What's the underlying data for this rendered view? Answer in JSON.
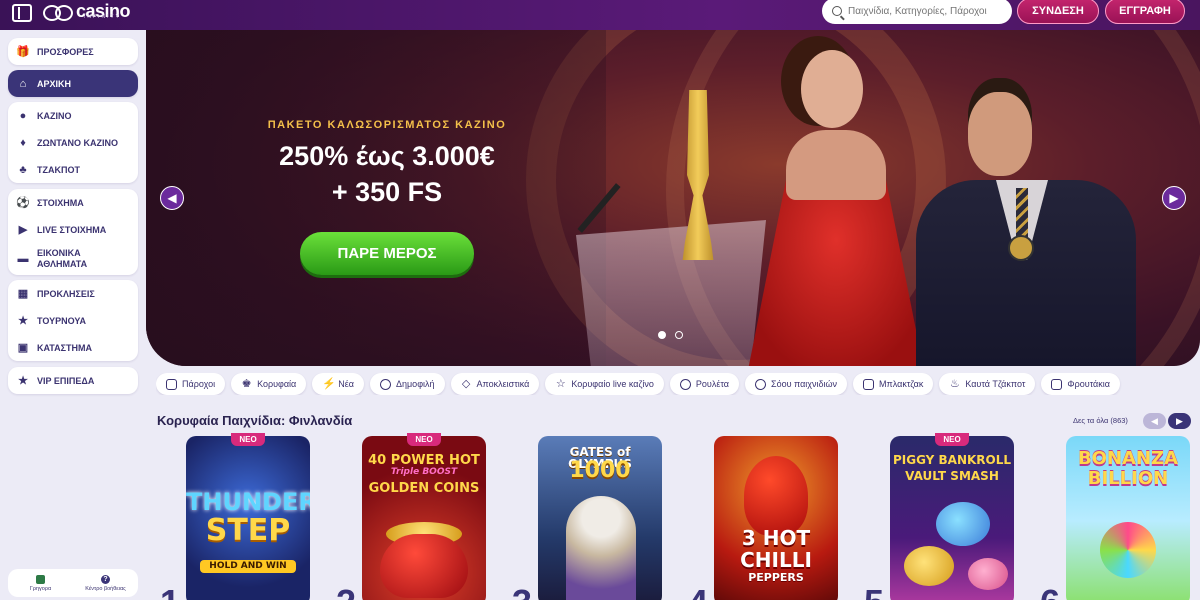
{
  "header": {
    "logo_text": "casino",
    "logo_sub": "INFINITY",
    "search_placeholder": "Παιχνίδια, Κατηγορίες, Πάροχοι",
    "login_label": "ΣΥΝΔΕΣΗ",
    "register_label": "ΕΓΓΡΑΦΗ",
    "accent_color": "#c4256e",
    "bar_color": "#4a155f"
  },
  "sidebar": {
    "items": [
      {
        "label": "ΠΡΟΣΦΟΡΕΣ",
        "icon": "gift-icon"
      },
      {
        "label": "ΑΡΧΙΚΗ",
        "icon": "home-icon",
        "active": true
      },
      {
        "label": "ΚΑΖΙΝΟ",
        "icon": "cherries-icon"
      },
      {
        "label": "ΖΩΝΤΑΝΟ ΚΑΖΙΝΟ",
        "icon": "cards-icon"
      },
      {
        "label": "ΤΖΑΚΠΟΤ",
        "icon": "clover-icon"
      },
      {
        "label": "ΣΤΟΙΧΗΜΑ",
        "icon": "soccer-ball-icon"
      },
      {
        "label": "LIVE ΣΤΟΙΧΗΜΑ",
        "icon": "live-play-icon"
      },
      {
        "label": "ΕΙΚΟΝΙΚΑ ΑΘΛΗΜΑΤΑ",
        "icon": "virtual-car-icon"
      },
      {
        "label": "ΠΡΟΚΛΗΣΕΙΣ",
        "icon": "challenge-icon"
      },
      {
        "label": "ΤΟΥΡΝΟΥΑ",
        "icon": "trophy-icon"
      },
      {
        "label": "ΚΑΤΑΣΤΗΜΑ",
        "icon": "shop-icon"
      },
      {
        "label": "VIP ΕΠΙΠΕΔΑ",
        "icon": "star-icon"
      }
    ],
    "footer": [
      {
        "label": "Γρηγορα",
        "icon": "language-flag-icon"
      },
      {
        "label": "Κέντρο βοήθειας",
        "icon": "help-icon"
      }
    ]
  },
  "hero": {
    "kicker": "ΠΑΚΕΤΟ ΚΑΛΩΣΟΡΙΣΜΑΤΟΣ ΚΑΖΙΝΟ",
    "title": "250% έως 3.000€",
    "subtitle": "+ 350 FS",
    "cta_label": "ΠΑΡΕ ΜΕΡΟΣ",
    "prev_icon": "chevron-left-icon",
    "next_icon": "chevron-right-icon",
    "slide_count": 2,
    "active_slide": 1
  },
  "categories": [
    {
      "label": "Πάροχοι",
      "icon": "providers-icon"
    },
    {
      "label": "Κορυφαία",
      "icon": "crown-icon"
    },
    {
      "label": "Νέα",
      "icon": "new-icon"
    },
    {
      "label": "Δημοφιλή",
      "icon": "popular-icon"
    },
    {
      "label": "Αποκλειστικά",
      "icon": "diamond-icon"
    },
    {
      "label": "Κορυφαίο live καζίνο",
      "icon": "star-icon"
    },
    {
      "label": "Ρουλέτα",
      "icon": "roulette-icon"
    },
    {
      "label": "Σόου παιχνιδιών",
      "icon": "microphone-icon"
    },
    {
      "label": "Μπλακτζακ",
      "icon": "cards-icon"
    },
    {
      "label": "Καυτά Τζάκποτ",
      "icon": "flame-icon"
    },
    {
      "label": "Φρουτάκια",
      "icon": "slot-icon"
    }
  ],
  "section": {
    "title": "Κορυφαία Παιχνίδια: Φινλανδία",
    "see_all": "Δες τα όλα (863)",
    "prev_icon": "chevron-left-icon",
    "next_icon": "chevron-right-icon"
  },
  "games": [
    {
      "rank": "1",
      "badge": "ΝΕΟ",
      "title_lines": [
        "THUNDER",
        "STEP",
        "HOLD AND WIN"
      ]
    },
    {
      "rank": "2",
      "badge": "ΝΕΟ",
      "title_lines": [
        "40 POWER HOT",
        "Triple BOOST",
        "GOLDEN COINS"
      ]
    },
    {
      "rank": "3",
      "badge": "",
      "title_lines": [
        "GATES of OLYMPUS",
        "1000"
      ]
    },
    {
      "rank": "4",
      "badge": "",
      "title_lines": [
        "3 HOT",
        "CHILLI",
        "PEPPERS"
      ]
    },
    {
      "rank": "5",
      "badge": "ΝΕΟ",
      "title_lines": [
        "PIGGY BANKROLL",
        "VAULT SMASH"
      ]
    },
    {
      "rank": "6",
      "badge": "",
      "title_lines": [
        "BONANZA",
        "BILLION"
      ]
    }
  ]
}
